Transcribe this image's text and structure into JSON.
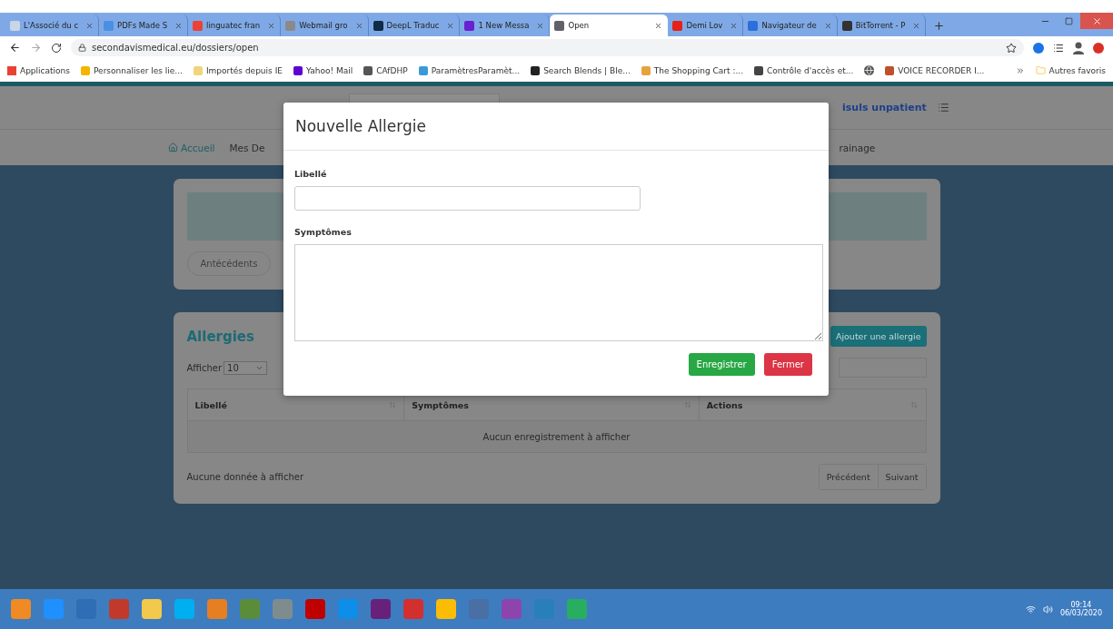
{
  "browser": {
    "tabs": [
      {
        "title": "L'Associé du c",
        "selected": false,
        "color": "#c9d6e6"
      },
      {
        "title": "PDFs Made S",
        "selected": false,
        "color": "#4a90e2"
      },
      {
        "title": "linguatec fran",
        "selected": false,
        "color": "#ea4335"
      },
      {
        "title": "Webmail gro",
        "selected": false,
        "color": "#8a8a8a"
      },
      {
        "title": "DeepL Traduc",
        "selected": false,
        "color": "#0f2b46"
      },
      {
        "title": "1 New Messa",
        "selected": false,
        "color": "#6a1fd0"
      },
      {
        "title": "Open",
        "selected": true,
        "color": "#5f6368"
      },
      {
        "title": "Demi Lov",
        "selected": false,
        "color": "#e62117"
      },
      {
        "title": "Navigateur de",
        "selected": false,
        "color": "#2a6fdb"
      },
      {
        "title": "BitTorrent - P",
        "selected": false,
        "color": "#333333"
      }
    ],
    "address": "secondavismedical.eu/dossiers/open",
    "bookmarks": [
      {
        "kind": "apps",
        "label": "Applications",
        "color": "#e94235"
      },
      {
        "kind": "link",
        "label": "Personnaliser les lie...",
        "color": "#f4b400"
      },
      {
        "kind": "link",
        "label": "Importés depuis IE",
        "color": "#f2d57a"
      },
      {
        "kind": "link",
        "label": "Yahoo! Mail",
        "color": "#6001d2"
      },
      {
        "kind": "link",
        "label": "CAfDHP",
        "color": "#555555"
      },
      {
        "kind": "link",
        "label": "ParamètresParamèt...",
        "color": "#3a9ad9"
      },
      {
        "kind": "link",
        "label": "Search Blends | Ble...",
        "color": "#222222"
      },
      {
        "kind": "link",
        "label": "The Shopping Cart :...",
        "color": "#e6a23c"
      },
      {
        "kind": "link",
        "label": "Contrôle d'accès et...",
        "color": "#444444"
      },
      {
        "kind": "globe",
        "color": "#555555"
      },
      {
        "kind": "link",
        "label": "VOICE RECORDER I...",
        "color": "#c0502a"
      }
    ],
    "other_bookmarks": "Autres favoris"
  },
  "page": {
    "header_link": "isuls unpatient",
    "nav_left": [
      {
        "label": "Accueil",
        "kind": "home"
      },
      {
        "label": "Mes De",
        "kind": "text"
      }
    ],
    "nav_right": "rainage",
    "history_pills": [
      {
        "label": "Antécédents",
        "selected": false
      }
    ],
    "allergies": {
      "title": "Allergies",
      "add_button": "Ajouter une allergie",
      "show_label": "Afficher",
      "page_size": "10",
      "columns": [
        "Libellé",
        "Symptômes",
        "Actions"
      ],
      "empty_row": "Aucun enregistrement à afficher",
      "info": "Aucune donnée à afficher",
      "pager": [
        "Précédent",
        "Suivant"
      ]
    }
  },
  "modal": {
    "title": "Nouvelle Allergie",
    "fields": [
      {
        "label": "Libellé",
        "kind": "input"
      },
      {
        "label": "Symptômes",
        "kind": "textarea"
      }
    ],
    "buttons": [
      {
        "label": "Enregistrer",
        "kind": "primary"
      },
      {
        "label": "Fermer",
        "kind": "danger"
      }
    ]
  },
  "taskbar": {
    "apps": [
      {
        "color": "#f08a24"
      },
      {
        "color": "#1e90ff"
      },
      {
        "color": "#2f6db5"
      },
      {
        "color": "#c0392b"
      },
      {
        "color": "#f2c94c"
      },
      {
        "color": "#00aff0"
      },
      {
        "color": "#e67e22"
      },
      {
        "color": "#5b8c3a"
      },
      {
        "color": "#7f8c8d"
      },
      {
        "color": "#bf0000"
      },
      {
        "color": "#0e8ee9"
      },
      {
        "color": "#68217a"
      },
      {
        "color": "#d32f2f"
      },
      {
        "color": "#fbbc05"
      },
      {
        "color": "#4a6fa5"
      },
      {
        "color": "#8e44ad"
      },
      {
        "color": "#2980b9"
      },
      {
        "color": "#27ae60"
      }
    ],
    "time": "09:14",
    "date": "06/03/2020"
  }
}
